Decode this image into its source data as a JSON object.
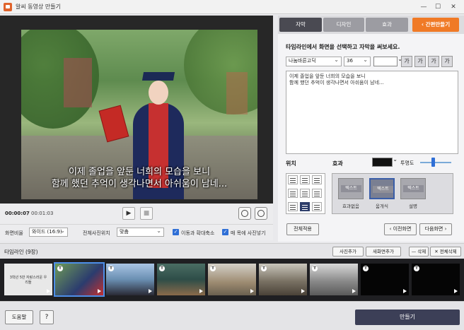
{
  "window": {
    "title": "알씨 동영상 만들기",
    "controls": [
      "—",
      "☐",
      "✕"
    ]
  },
  "video": {
    "subtitle_line1": "이제 졸업을 앞둔 너희의 모습을 보니",
    "subtitle_line2": "함께 했던 추억이 생각나면서 아쉬움이 남네..."
  },
  "player": {
    "current_time": "00:00:07",
    "separator": "/",
    "total_time": "00:01:03",
    "play_icon": "▶",
    "stop_icon": "■"
  },
  "options": {
    "ratio_label": "화면비율",
    "ratio_value": "와이드 (16:9)",
    "photo_pos_label": "전체사진위치",
    "photo_pos_value": "맞춤",
    "move_zoom_label": "이동과 확대축소",
    "transition_label": "매 목에 사진넣기"
  },
  "panel": {
    "tabs": [
      {
        "label": "자막",
        "active": true
      },
      {
        "label": "디자인",
        "active": false
      },
      {
        "label": "효과",
        "active": false
      }
    ],
    "simple_button": "‹ 간편만들기",
    "instruction": "타임라인에서 화면을 선택하고 자막을 써보세요.",
    "font": "나눔바른고딕",
    "size": "36",
    "format_buttons": [
      "가",
      "가",
      "가",
      "가"
    ],
    "text_line1": "이제 졸업을 앞둔 너희의 모습을 보니",
    "text_line2": "함께 했던 추억이 생각나면서 아쉬움이 남네...",
    "position_label": "위치",
    "effect_label": "효과",
    "opacity_label": "투명도",
    "opacity_value": 0.4,
    "effects": [
      {
        "thumb_text": "텍스트",
        "name": "효과없음",
        "selected": false
      },
      {
        "thumb_text": "텍스트",
        "name": "움개식",
        "selected": true
      },
      {
        "thumb_text": "텍스트",
        "name": "설명",
        "selected": false
      }
    ],
    "apply_all": "전체적용",
    "prev_screen": "‹ 이전화면",
    "next_screen": "다음화면 ›"
  },
  "timeline": {
    "title": "타임라인 (9장)",
    "add_photo": "사진추가",
    "add_screen": "새화면추가",
    "delete": "— 삭제",
    "delete_all": "✕ 전체삭제",
    "first_thumb_caption": "3학년 5반 자랑스러운 우리들",
    "badge_letter": "T"
  },
  "bottom": {
    "help": "도움말",
    "question": "?",
    "make": "만들기"
  }
}
